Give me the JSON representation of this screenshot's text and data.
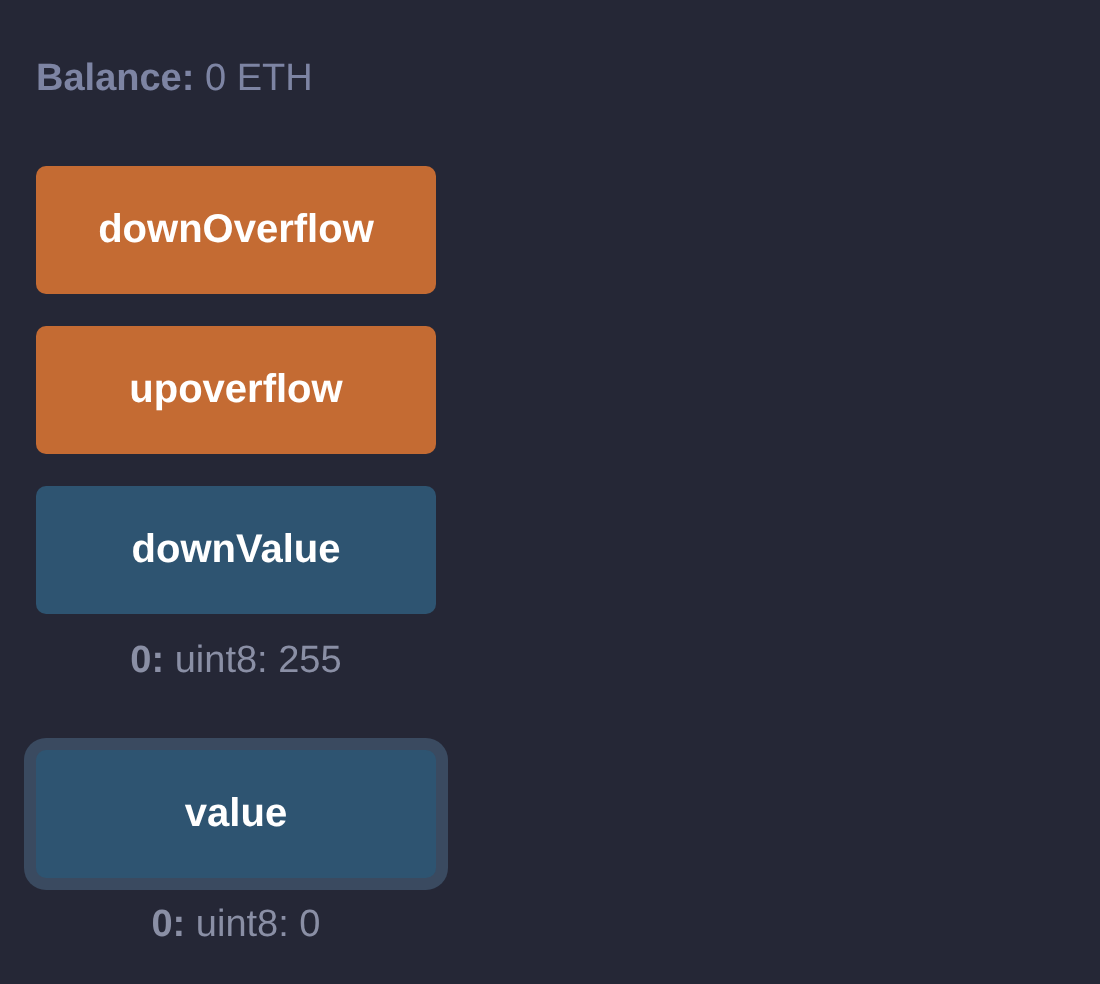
{
  "balance": "**Balance:** 0 ETH",
  "functions": [
    {
      "label": "downOverflow",
      "kind": "transact",
      "focused": false
    },
    {
      "label": "upoverflow",
      "kind": "transact",
      "focused": false
    },
    {
      "label": "downValue",
      "kind": "call",
      "focused": false,
      "output": "**0:** uint8: 255"
    },
    {
      "label": "value",
      "kind": "call",
      "focused": true,
      "output": "**0:** uint8: 0"
    }
  ]
}
